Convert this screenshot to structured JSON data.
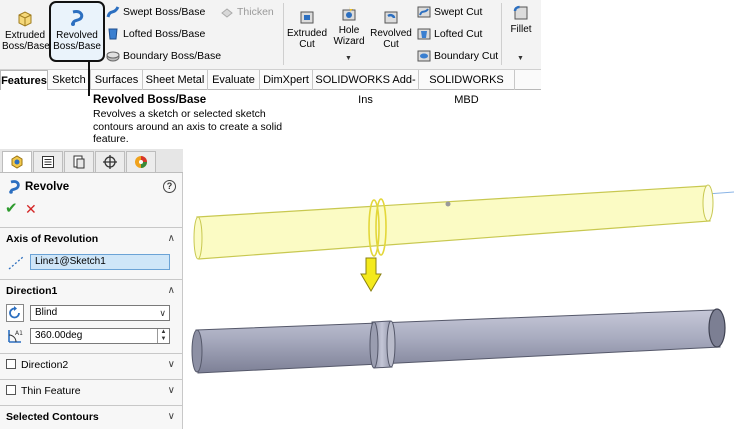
{
  "ribbon": {
    "extruded_boss": "Extruded Boss/Base",
    "revolved_boss": "Revolved Boss/Base",
    "swept_boss": "Swept Boss/Base",
    "lofted_boss": "Lofted Boss/Base",
    "boundary_boss": "Boundary Boss/Base",
    "thicken": "Thicken",
    "extruded_cut": "Extruded Cut",
    "hole_wizard": "Hole Wizard",
    "revolved_cut": "Revolved Cut",
    "swept_cut": "Swept Cut",
    "lofted_cut": "Lofted Cut",
    "boundary_cut": "Boundary Cut",
    "fillet": "Fillet"
  },
  "tabs": [
    "Features",
    "Sketch",
    "Surfaces",
    "Sheet Metal",
    "Evaluate",
    "DimXpert",
    "SOLIDWORKS Add-Ins",
    "SOLIDWORKS MBD"
  ],
  "tooltip": {
    "title": "Revolved Boss/Base",
    "description": "Revolves a sketch or selected sketch contours around an axis to create a solid feature."
  },
  "property_manager": {
    "title": "Revolve",
    "help": "?",
    "ok": "✔",
    "cancel": "✕",
    "axis_section": "Axis of Revolution",
    "axis_value": "Line1@Sketch1",
    "direction1_section": "Direction1",
    "direction1_type": "Blind",
    "angle": "360.00deg",
    "direction2_section": "Direction2",
    "thin_feature_section": "Thin Feature",
    "selected_contours_section": "Selected Contours"
  },
  "colors": {
    "preview_fill": "#fbfbc4",
    "preview_stroke": "#c8c850",
    "solid_fill": "#a9acbf",
    "arrow_fill": "#f4ea1c",
    "ribbon_bg": "#f3f3f3",
    "highlight_border": "#111111"
  }
}
